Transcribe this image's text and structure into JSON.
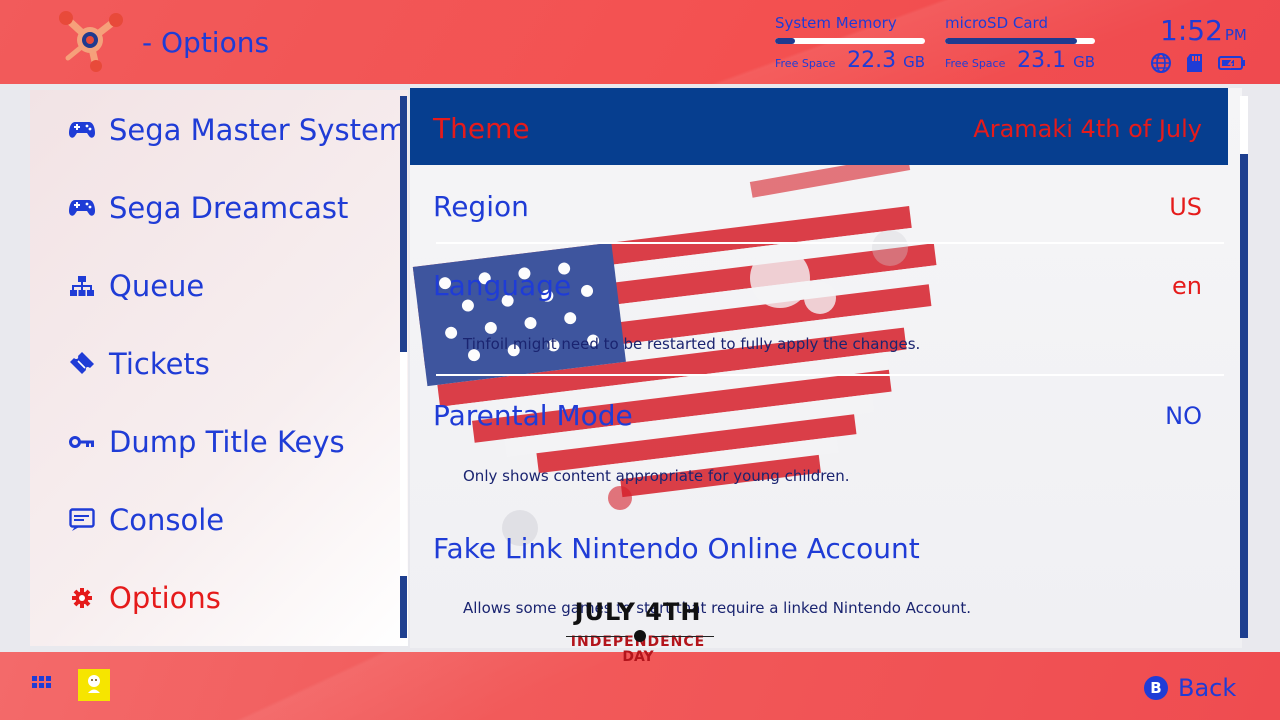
{
  "header": {
    "title": "- Options",
    "logo_icon": "tinfoil-logo-icon",
    "storage": [
      {
        "label": "System Memory",
        "free_label": "Free Space",
        "value": "22.3",
        "unit": "GB",
        "fill": 0.13
      },
      {
        "label": "microSD Card",
        "free_label": "Free Space",
        "value": "23.1",
        "unit": "GB",
        "fill": 0.88
      }
    ],
    "clock": {
      "time": "1:52",
      "ampm": "PM"
    },
    "status_icons": [
      "globe-icon",
      "sd-card-icon",
      "battery-charging-icon"
    ]
  },
  "sidebar": {
    "items": [
      {
        "label": "Sega Master System",
        "icon": "gamepad-icon",
        "active": false
      },
      {
        "label": "Sega Dreamcast",
        "icon": "gamepad-icon",
        "active": false
      },
      {
        "label": "Queue",
        "icon": "hierarchy-icon",
        "active": false
      },
      {
        "label": "Tickets",
        "icon": "ticket-icon",
        "active": false
      },
      {
        "label": "Dump Title Keys",
        "icon": "key-icon",
        "active": false
      },
      {
        "label": "Console",
        "icon": "console-icon",
        "active": false
      },
      {
        "label": "Options",
        "icon": "gear-icon",
        "active": true
      }
    ]
  },
  "options": {
    "rows": [
      {
        "label": "Theme",
        "value": "Aramaki 4th of July",
        "selected": true
      },
      {
        "label": "Region",
        "value": "US",
        "value_color": "#e51b1b"
      },
      {
        "label": "Language",
        "value": "en",
        "value_color": "#e51b1b",
        "description": "Tinfoil might need to be restarted to fully apply the changes."
      },
      {
        "label": "Parental Mode",
        "value": "NO",
        "value_color": "#1f3cd6",
        "description": "Only shows content appropriate for young children."
      },
      {
        "label": "Fake Link Nintendo Online Account",
        "value": "",
        "description": "Allows some games to start that require a linked Nintendo Account."
      }
    ]
  },
  "theme_badge": {
    "line1": "JULY 4TH",
    "line2": "INDEPENDENCE",
    "line3": "DAY"
  },
  "footer": {
    "apps_icon": "grid-icon",
    "avatar_icon": "user-avatar",
    "back_button_glyph": "B",
    "back_label": "Back"
  },
  "colors": {
    "accent": "#1f3cd6",
    "header_bg": "#f35050",
    "selected_row": "#063e8f",
    "active_text": "#e51b1b"
  }
}
